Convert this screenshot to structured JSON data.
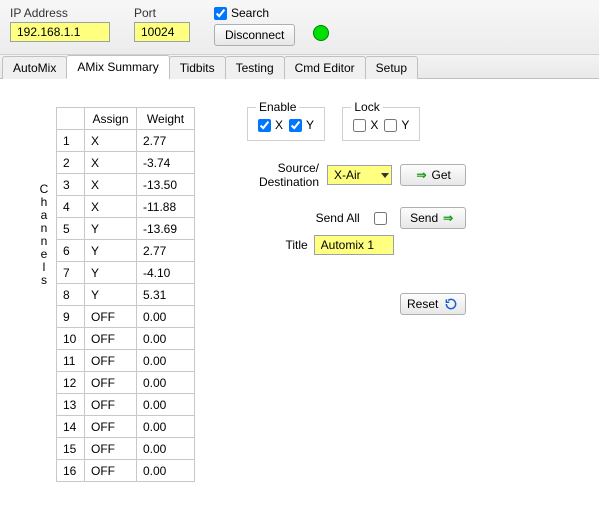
{
  "top": {
    "ip_label": "IP Address",
    "ip_value": "192.168.1.1",
    "port_label": "Port",
    "port_value": "10024",
    "search_label": "Search",
    "search_checked": true,
    "disconnect_label": "Disconnect",
    "status_color": "#00e000"
  },
  "tabs": [
    {
      "label": "AutoMix",
      "selected": false
    },
    {
      "label": "AMix Summary",
      "selected": true
    },
    {
      "label": "Tidbits",
      "selected": false
    },
    {
      "label": "Testing",
      "selected": false
    },
    {
      "label": "Cmd Editor",
      "selected": false
    },
    {
      "label": "Setup",
      "selected": false
    }
  ],
  "vertical_label": "Channels",
  "table": {
    "headers": {
      "assign": "Assign",
      "weight": "Weight"
    },
    "rows": [
      {
        "idx": "1",
        "assign": "X",
        "weight": "2.77"
      },
      {
        "idx": "2",
        "assign": "X",
        "weight": "-3.74"
      },
      {
        "idx": "3",
        "assign": "X",
        "weight": "-13.50"
      },
      {
        "idx": "4",
        "assign": "X",
        "weight": "-11.88"
      },
      {
        "idx": "5",
        "assign": "Y",
        "weight": "-13.69"
      },
      {
        "idx": "6",
        "assign": "Y",
        "weight": "2.77"
      },
      {
        "idx": "7",
        "assign": "Y",
        "weight": "-4.10"
      },
      {
        "idx": "8",
        "assign": "Y",
        "weight": "5.31"
      },
      {
        "idx": "9",
        "assign": "OFF",
        "weight": "0.00"
      },
      {
        "idx": "10",
        "assign": "OFF",
        "weight": "0.00"
      },
      {
        "idx": "11",
        "assign": "OFF",
        "weight": "0.00"
      },
      {
        "idx": "12",
        "assign": "OFF",
        "weight": "0.00"
      },
      {
        "idx": "13",
        "assign": "OFF",
        "weight": "0.00"
      },
      {
        "idx": "14",
        "assign": "OFF",
        "weight": "0.00"
      },
      {
        "idx": "15",
        "assign": "OFF",
        "weight": "0.00"
      },
      {
        "idx": "16",
        "assign": "OFF",
        "weight": "0.00"
      }
    ]
  },
  "right": {
    "enable": {
      "legend": "Enable",
      "x_label": "X",
      "x_checked": true,
      "y_label": "Y",
      "y_checked": true
    },
    "lock": {
      "legend": "Lock",
      "x_label": "X",
      "x_checked": false,
      "y_label": "Y",
      "y_checked": false
    },
    "source_label": "Source/\nDestination",
    "source_value": "X-Air",
    "get_label": "Get",
    "send_all_label": "Send All",
    "send_all_checked": false,
    "send_label": "Send",
    "title_label": "Title",
    "title_value": "Automix 1",
    "reset_label": "Reset"
  }
}
